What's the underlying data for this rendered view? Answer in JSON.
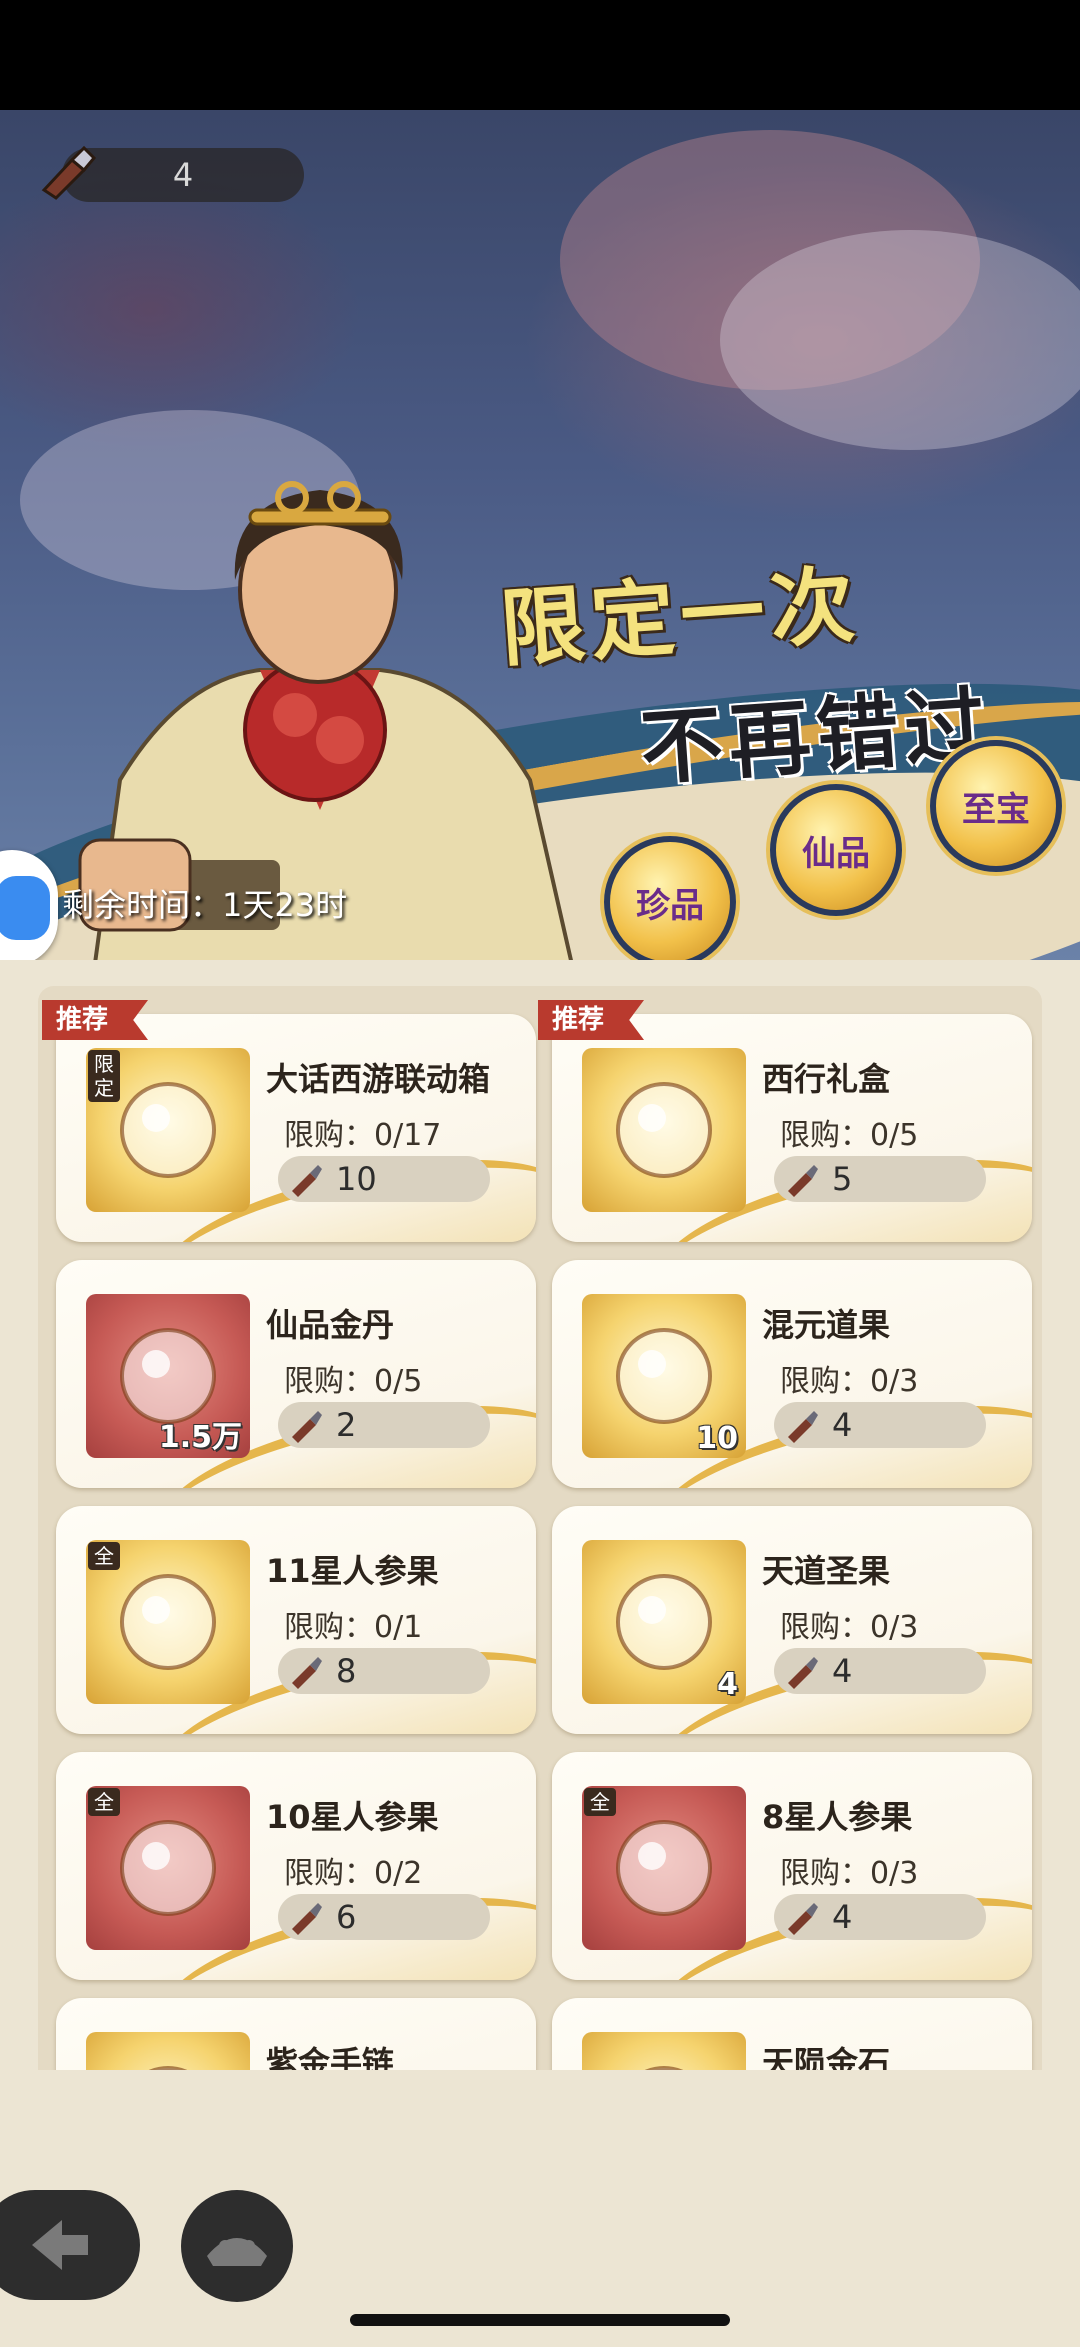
{
  "header": {
    "currency_value": "4",
    "slogan_line1": "限定一次",
    "slogan_line2": "不再错过",
    "timer_label": "剩余时间：1天23时"
  },
  "tiers": [
    {
      "label": "珍品"
    },
    {
      "label": "仙品"
    },
    {
      "label": "至宝"
    }
  ],
  "cards": [
    {
      "tag": "推荐",
      "name": "大话西游联动箱",
      "limit": "限购：0/17",
      "price": "10",
      "badge": "",
      "corner": "限定",
      "thumb": "gold",
      "icon": "treasure-box-icon"
    },
    {
      "tag": "推荐",
      "name": "西行礼盒",
      "limit": "限购：0/5",
      "price": "5",
      "badge": "",
      "corner": "",
      "thumb": "gold",
      "icon": "gift-chest-icon"
    },
    {
      "tag": "",
      "name": "仙品金丹",
      "limit": "限购：0/5",
      "price": "2",
      "badge": "1.5万",
      "corner": "",
      "thumb": "red",
      "icon": "golden-pill-icon"
    },
    {
      "tag": "",
      "name": "混元道果",
      "limit": "限购：0/3",
      "price": "4",
      "badge": "10",
      "corner": "",
      "thumb": "gold",
      "icon": "dao-fruit-icon"
    },
    {
      "tag": "",
      "name": "11星人参果",
      "limit": "限购：0/1",
      "price": "8",
      "badge": "",
      "corner": "全",
      "thumb": "gold",
      "icon": "ginseng-fruit-icon"
    },
    {
      "tag": "",
      "name": "天道圣果",
      "limit": "限购：0/3",
      "price": "4",
      "badge": "4",
      "corner": "",
      "thumb": "gold",
      "icon": "peach-fruit-icon"
    },
    {
      "tag": "",
      "name": "10星人参果",
      "limit": "限购：0/2",
      "price": "6",
      "badge": "",
      "corner": "全",
      "thumb": "red",
      "icon": "ginseng-fruit-icon"
    },
    {
      "tag": "",
      "name": "8星人参果",
      "limit": "限购：0/3",
      "price": "4",
      "badge": "",
      "corner": "全",
      "thumb": "red",
      "icon": "ginseng-fruit-icon"
    },
    {
      "tag": "",
      "name": "紫金手链",
      "limit": "",
      "price": "",
      "badge": "",
      "corner": "",
      "thumb": "gold",
      "icon": "bracelet-icon"
    },
    {
      "tag": "",
      "name": "天陨金石",
      "limit": "",
      "price": "",
      "badge": "",
      "corner": "",
      "thumb": "gold",
      "icon": "meteor-stone-icon"
    }
  ],
  "nav": {
    "back_icon": "arrow-left-icon",
    "home_icon": "home-creature-icon"
  }
}
